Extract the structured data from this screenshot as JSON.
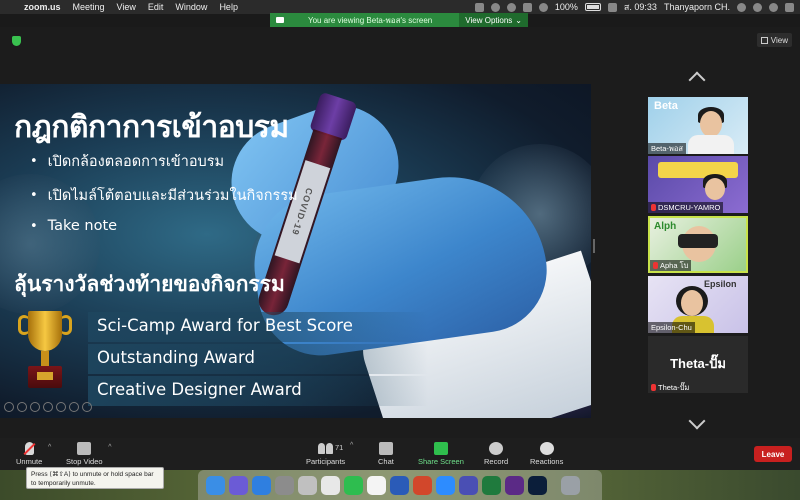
{
  "menubar": {
    "app_name": "zoom.us",
    "menu": [
      "Meeting",
      "View",
      "Edit",
      "Window",
      "Help"
    ],
    "battery": "100%",
    "clock": "ส. 09:33",
    "user": "Thanyaporn CH."
  },
  "share_banner": {
    "message": "You are viewing Beta-พอส's screen",
    "view_options": "View Options"
  },
  "view_button": "View",
  "slide": {
    "title": "กฎกติกาการเข้าอบรม",
    "bullets": [
      "เปิดกล้องตลอดการเข้าอบรม",
      "เปิดไมล์โต้ตอบและมีส่วนร่วมในกิจกรรม",
      "Take note"
    ],
    "subtitle": "ลุ้นรางวัลช่วงท้ายของกิจกรรม",
    "awards": [
      "Sci-Camp Award for Best Score",
      "Outstanding Award",
      "Creative Designer Award"
    ],
    "tube_label": "COVID-19"
  },
  "participants": [
    {
      "name": "Beta-พอส",
      "logo": "Beta",
      "muted": false
    },
    {
      "name": "DSMCRU-YAMRO",
      "logo": "",
      "muted": true
    },
    {
      "name": "Apha โบ",
      "logo": "Alph",
      "muted": true,
      "active": true
    },
    {
      "name": "Epsilon-Chu",
      "logo": "Epsilon",
      "muted": false
    },
    {
      "name": "Theta-ปั๊ม",
      "logo": "",
      "muted": true,
      "display_text": "Theta-ปั๊ม"
    }
  ],
  "toolbar": {
    "unmute": "Unmute",
    "stop_video": "Stop Video",
    "participants": "Participants",
    "participant_count": "71",
    "chat": "Chat",
    "share_screen": "Share Screen",
    "record": "Record",
    "reactions": "Reactions",
    "leave": "Leave"
  },
  "tooltip": "Press ⟨⌘⇧A⟩ to unmute or hold space bar to temporarily unmute.",
  "colors": {
    "share_green": "#2b8a3e",
    "leave_red": "#c8201f",
    "active_speaker": "#c8e24a"
  }
}
